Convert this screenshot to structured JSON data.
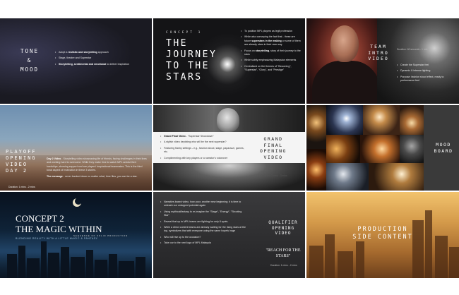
{
  "tone": {
    "title": "TONE\n&\nMOOD",
    "items": [
      {
        "pre": "Adopt a ",
        "bold": "realistic and storytelling",
        "post": " approach"
      },
      {
        "pre": "Stage, theatre and Superstar",
        "bold": "",
        "post": ""
      },
      {
        "pre": "",
        "bold": "Storytelling, sentimental and emotional",
        "post": " to deliver inspiration"
      }
    ]
  },
  "concept1": {
    "kicker": "CONCEPT 1",
    "title": "THE JOURNEY TO THE STARS",
    "items": [
      {
        "pre": "To position MPL players as legit profession",
        "bold": "",
        "post": ""
      },
      {
        "pre": "While also conveying the fact that - these are future ",
        "bold": "superstars in the making",
        "post": " or some of them are already stars in their own way"
      },
      {
        "pre": "Focus on ",
        "bold": "storytelling",
        "post": ", story of their journey to the stars"
      },
      {
        "pre": "While subtly emphasizing Malaysian elements",
        "bold": "",
        "post": ""
      },
      {
        "pre": "Centralised on the themes of \"Becoming\", \"Superstar\", \"Glory\", and \"Prestige\"",
        "bold": "",
        "post": ""
      }
    ]
  },
  "team_intro": {
    "title": "TEAM INTRO VIDEO",
    "duration": "Duration: 60 seconds - 1 min",
    "items": [
      "Create the Superstar feel",
      "Dynamic & intense lighting",
      "Purpose: fashion shoot effect, ready to performance feel"
    ]
  },
  "playoff": {
    "title": "PLAYOFF OPENING VIDEO DAY 2",
    "duration": "Duration: 1 mins - 2 mins",
    "para1_bold": "Day 2 Video",
    "para1": " - Storytelling video showcasing life of friends, facing challenges in their lives and working hard to overcome. While they make time to watch MPL amidst their hardships, showing support and are players' inspirational teammates. This is the third tonal aspect of motivation in these 3 stories.",
    "para2_bold": "The message",
    "para2": " - never backed down no matter what, time flies, you can be a star."
  },
  "grand_final": {
    "title": "GRAND FINAL OPENING VIDEO",
    "duration": "Duration: 2 mins - 3 mins",
    "items": [
      {
        "bold": "Grand Final Video",
        "text": " - \"Superstar Showdown\""
      },
      {
        "bold": "",
        "text": "A stylish video depicting who will be the next superstar?"
      },
      {
        "bold": "",
        "text": "Featuring flashy settings - e.g., fashion shoot, stage, paparazzi, games, etc."
      },
      {
        "bold": "",
        "text": "Complimenting with key players or a narrator's voiceover"
      }
    ]
  },
  "moodboard": {
    "title": "MOOD BOARD"
  },
  "concept2": {
    "title": "CONCEPT 2\nTHE MAGIC WITHIN",
    "kicker": "SEQUENCE OF SOLID PRODUCTION",
    "tagline": "BLENDING REALITY WITH A LITTLE MAGIC & FANTASY"
  },
  "qualifier": {
    "title": "QUALIFIER OPENING VIDEO",
    "subtitle": "\"REACH FOR THE STARS\"",
    "duration": "Duration: 1 mins - 2 mins",
    "items": [
      "Narrative-based video, how poor, another new beginning; it is time to unleash our untapped potential again",
      "Using mythical/fantasy to re-imagine the \"Stage\", \"Energy\", \"Shooting Star\"",
      "Reveal that up to MPL teams are fighting for only 8 spots.",
      "While a direct content teams are already waiting for the rising stars at the top, symbolizes that with everyone using the same hopeful rage",
      "Who will rise up to the occasion?",
      "Take our to the next logo of MPL Malaysia"
    ]
  },
  "production": {
    "title": "PRODUCTION SIDE CONTENT"
  },
  "colors": {
    "dark_bg": "#141416",
    "accent_gold": "#d49a4a",
    "text_white": "#ffffff"
  }
}
